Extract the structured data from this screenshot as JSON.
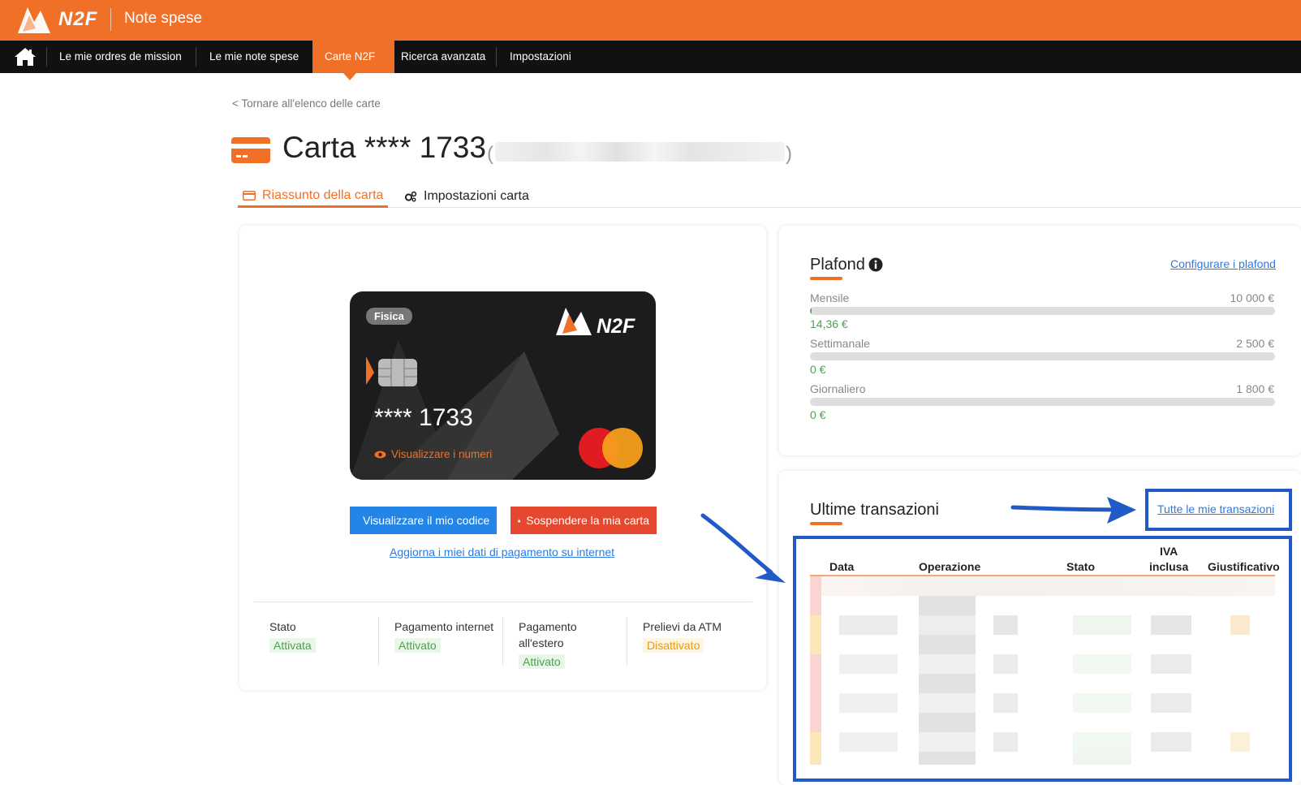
{
  "header": {
    "logo_text": "N2F",
    "app_title": "Note spese",
    "brand_color": "#f07028"
  },
  "nav": {
    "items": [
      {
        "label": "Le mie ordres de mission"
      },
      {
        "label": "Le mie note spese"
      },
      {
        "label": "Carte N2F"
      },
      {
        "label": "Ricerca avanzata"
      },
      {
        "label": "Impostazioni"
      }
    ],
    "active": "Carte N2F"
  },
  "page": {
    "back_link": "< Tornare all'elenco delle carte",
    "title": "Carta **** 1733",
    "paren_open": "(",
    "paren_close": ")"
  },
  "tabs": {
    "summary": "Riassunto della carta",
    "settings": "Impostazioni carta"
  },
  "card": {
    "badge": "Fisica",
    "brand": "N2F",
    "number": "**** 1733",
    "view_numbers": "Visualizzare i numeri"
  },
  "actions": {
    "view_code": "Visualizzare il mio codice",
    "suspend": "Sospendere la mia carta",
    "update_payment": "Aggiorna i miei dati di pagamento su internet"
  },
  "status": [
    {
      "label": "Stato",
      "value": "Attivata",
      "tone": "green"
    },
    {
      "label": "Pagamento internet",
      "value": "Attivato",
      "tone": "green"
    },
    {
      "label": "Pagamento all'estero",
      "value": "Attivato",
      "tone": "green"
    },
    {
      "label": "Prelievi da ATM",
      "value": "Disattivato",
      "tone": "orange"
    }
  ],
  "plafond": {
    "title": "Plafond",
    "config_link": "Configurare i plafond",
    "limits": [
      {
        "label": "Mensile",
        "max": "10 000 €",
        "used": "14,36 €",
        "fraction": 0.0014
      },
      {
        "label": "Settimanale",
        "max": "2 500 €",
        "used": "0 €",
        "fraction": 0
      },
      {
        "label": "Giornaliero",
        "max": "1 800 €",
        "used": "0 €",
        "fraction": 0
      }
    ]
  },
  "transactions": {
    "title": "Ultime transazioni",
    "all_link": "Tutte le mie transazioni",
    "columns": {
      "data": "Data",
      "operazione": "Operazione",
      "stato": "Stato",
      "iva_line1": "IVA",
      "iva_line2": "inclusa",
      "giustificativo": "Giustificativo"
    }
  },
  "colors": {
    "link": "#2d7ae0",
    "annotation": "#1f5ac6",
    "status_green": "#4ba34b",
    "status_orange": "#e89a14"
  }
}
